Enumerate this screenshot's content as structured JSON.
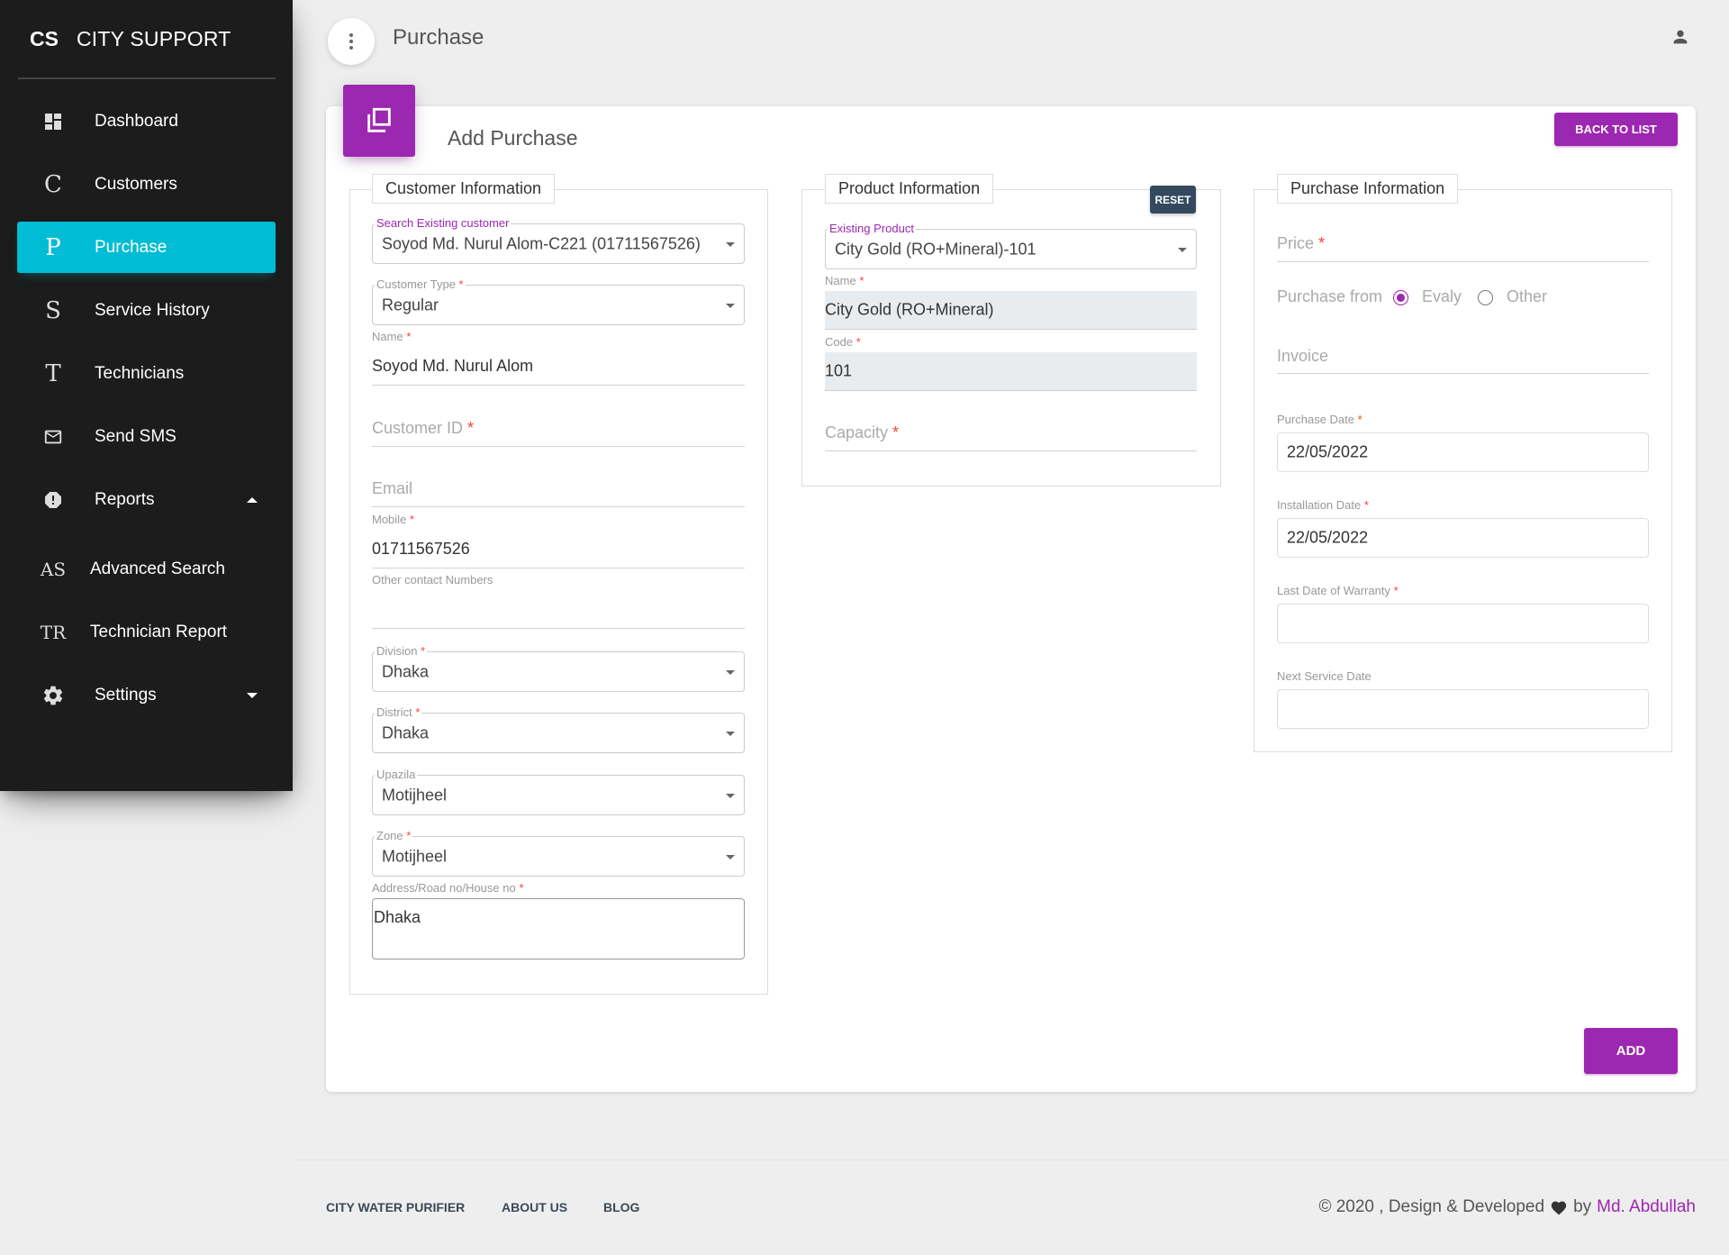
{
  "brand": {
    "mini": "CS",
    "full": "CITY SUPPORT"
  },
  "sidebar": {
    "items": [
      {
        "label": "Dashboard",
        "icon": "dashboard-icon"
      },
      {
        "label": "Customers",
        "icon": "C"
      },
      {
        "label": "Purchase",
        "icon": "P",
        "active": true
      },
      {
        "label": "Service History",
        "icon": "S"
      },
      {
        "label": "Technicians",
        "icon": "T"
      },
      {
        "label": "Send SMS",
        "icon": "mail-icon"
      },
      {
        "label": "Reports",
        "icon": "alert-icon"
      },
      {
        "label": "Advanced Search",
        "icon": "AS"
      },
      {
        "label": "Technician Report",
        "icon": "TR"
      },
      {
        "label": "Settings",
        "icon": "gear-icon"
      }
    ]
  },
  "topbar": {
    "title": "Purchase"
  },
  "card": {
    "title": "Add Purchase",
    "back_label": "BACK TO LIST",
    "add_label": "ADD"
  },
  "customer": {
    "legend": "Customer Information",
    "search_label": "Search Existing customer",
    "search_value": "Soyod Md. Nurul Alom-C221 (01711567526)",
    "type_label": "Customer Type",
    "type_value": "Regular",
    "name_label": "Name",
    "name_value": "Soyod Md. Nurul Alom",
    "id_placeholder": "Customer ID",
    "email_placeholder": "Email",
    "mobile_label": "Mobile",
    "mobile_value": "01711567526",
    "other_label": "Other contact Numbers",
    "division_label": "Division",
    "division_value": "Dhaka",
    "district_label": "District",
    "district_value": "Dhaka",
    "upazila_label": "Upazila",
    "upazila_value": "Motijheel",
    "zone_label": "Zone",
    "zone_value": "Motijheel",
    "address_label": "Address/Road no/House no",
    "address_value": "Dhaka",
    "required_mark": "*"
  },
  "product": {
    "legend": "Product Information",
    "reset_label": "RESET",
    "existing_label": "Existing Product",
    "existing_value": "City Gold (RO+Mineral)-101",
    "name_label": "Name",
    "name_value": "City Gold (RO+Mineral)",
    "code_label": "Code",
    "code_value": "101",
    "capacity_placeholder": "Capacity"
  },
  "purchase": {
    "legend": "Purchase Information",
    "price_placeholder": "Price",
    "from_label": "Purchase from",
    "from_options": [
      "Evaly",
      "Other"
    ],
    "from_selected": "Evaly",
    "invoice_placeholder": "Invoice",
    "purchase_date_label": "Purchase Date",
    "purchase_date_value": "22/05/2022",
    "install_date_label": "Installation Date",
    "install_date_value": "22/05/2022",
    "warranty_label": "Last Date of Warranty",
    "warranty_value": "",
    "next_service_label": "Next Service Date",
    "next_service_value": ""
  },
  "footer": {
    "links": [
      "CITY WATER PURIFIER",
      "ABOUT US",
      "BLOG"
    ],
    "copy_prefix": "© 2020 , Design & Developed",
    "copy_by": "by",
    "author": "Md. Abdullah"
  },
  "colors": {
    "primary": "#9c27b0",
    "active_nav": "#00bcd4",
    "sidebar_bg": "#1c1c1c",
    "reset_btn": "#34495e"
  }
}
